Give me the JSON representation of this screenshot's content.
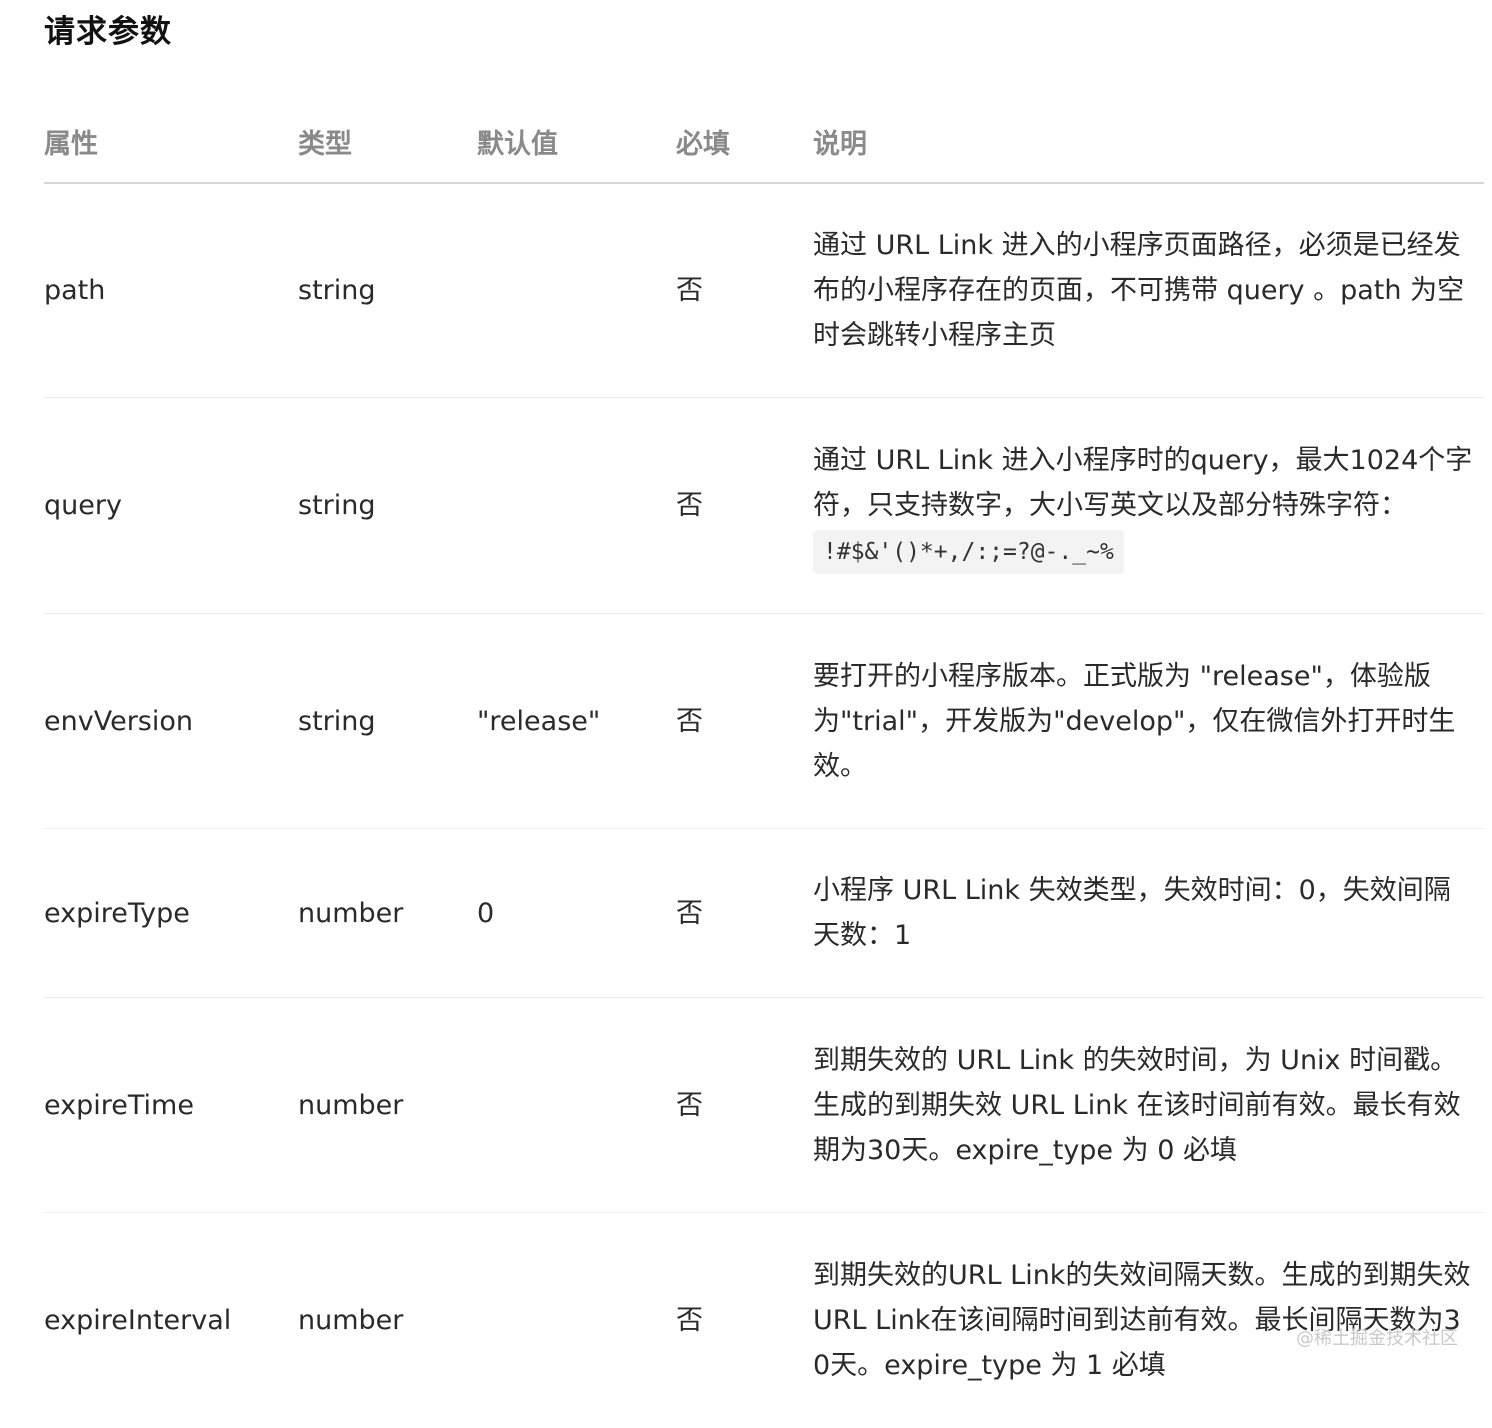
{
  "section_title": "请求参数",
  "table": {
    "headers": [
      "属性",
      "类型",
      "默认值",
      "必填",
      "说明"
    ],
    "rows": [
      {
        "name": "path",
        "type": "string",
        "default": "",
        "required": "否",
        "description": "通过 URL Link 进入的小程序页面路径，必须是已经发布的小程序存在的页面，不可携带 query 。path 为空时会跳转小程序主页",
        "code": ""
      },
      {
        "name": "query",
        "type": "string",
        "default": "",
        "required": "否",
        "description": "通过 URL Link 进入小程序时的query，最大1024个字符，只支持数字，大小写英文以及部分特殊字符：",
        "code": "!#$&'()*+,/:;=?@-._~%"
      },
      {
        "name": "envVersion",
        "type": "string",
        "default": "\"release\"",
        "required": "否",
        "description": "要打开的小程序版本。正式版为 \"release\"，体验版为\"trial\"，开发版为\"develop\"，仅在微信外打开时生效。",
        "code": ""
      },
      {
        "name": "expireType",
        "type": "number",
        "default": "0",
        "required": "否",
        "description": "小程序 URL Link 失效类型，失效时间：0，失效间隔天数：1",
        "code": ""
      },
      {
        "name": "expireTime",
        "type": "number",
        "default": "",
        "required": "否",
        "description": "到期失效的 URL Link 的失效时间，为 Unix 时间戳。生成的到期失效 URL Link 在该时间前有效。最长有效期为30天。expire_type 为 0 必填",
        "code": ""
      },
      {
        "name": "expireInterval",
        "type": "number",
        "default": "",
        "required": "否",
        "description": "到期失效的URL Link的失效间隔天数。生成的到期失效URL Link在该间隔时间到达前有效。最长间隔天数为30天。expire_type 为 1 必填",
        "code": ""
      }
    ]
  },
  "watermark": "@稀土掘金技术社区"
}
